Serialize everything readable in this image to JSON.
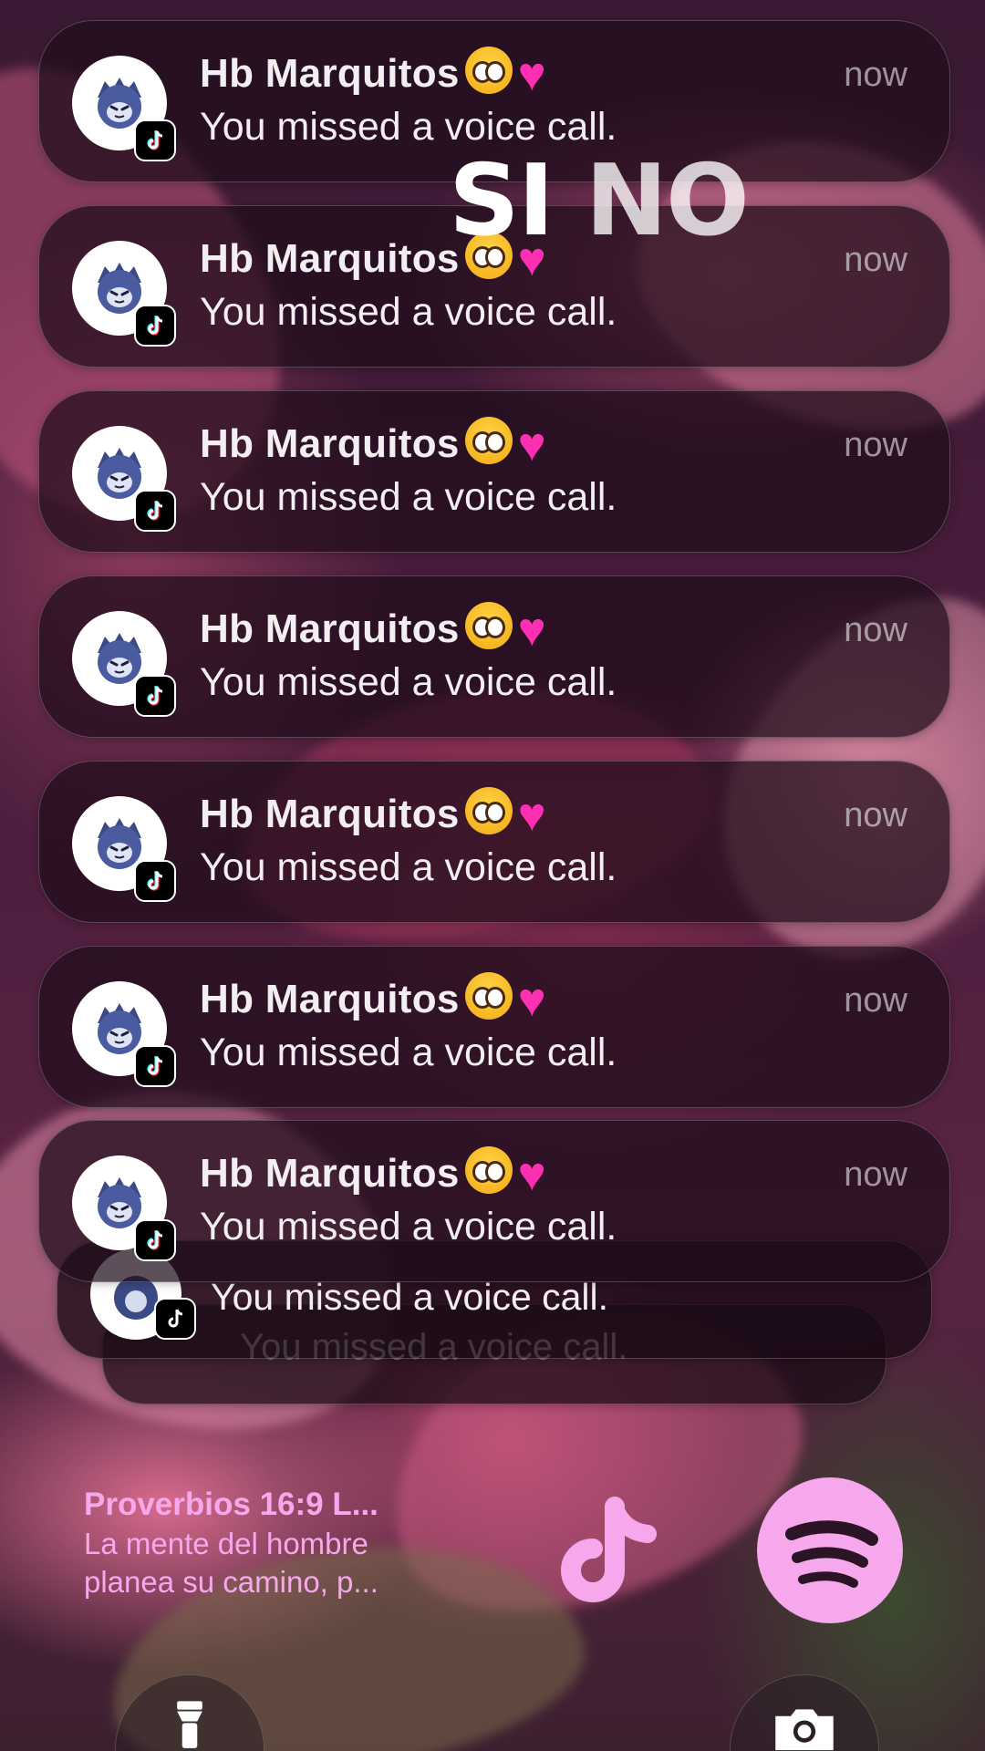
{
  "overlay": {
    "si": "SI",
    "no": "NO"
  },
  "notifications": [
    {
      "title": "Hb Marquitos",
      "time": "now",
      "body": "You missed a voice call."
    },
    {
      "title": "Hb Marquitos",
      "time": "now",
      "body": "You missed a voice call."
    },
    {
      "title": "Hb Marquitos",
      "time": "now",
      "body": "You missed a voice call."
    },
    {
      "title": "Hb Marquitos",
      "time": "now",
      "body": "You missed a voice call."
    },
    {
      "title": "Hb Marquitos",
      "time": "now",
      "body": "You missed a voice call."
    },
    {
      "title": "Hb Marquitos",
      "time": "now",
      "body": "You missed a voice call."
    },
    {
      "title": "Hb Marquitos",
      "time": "now",
      "body": "You missed a voice call."
    }
  ],
  "stacked": [
    {
      "body": "You missed a voice call."
    },
    {
      "body": "You missed a voice call."
    }
  ],
  "verse": {
    "title": "Proverbios 16:9 L...",
    "line1": "La mente del hombre",
    "line2": "planea su camino, p..."
  },
  "apps": {
    "tiktok_icon": "tiktok-icon",
    "spotify_icon": "spotify-icon"
  },
  "controls": {
    "flashlight_icon": "flashlight-icon",
    "camera_icon": "camera-icon"
  },
  "colors": {
    "widget_pink": "#f7a8ec",
    "heart": "#ff2fb3"
  }
}
